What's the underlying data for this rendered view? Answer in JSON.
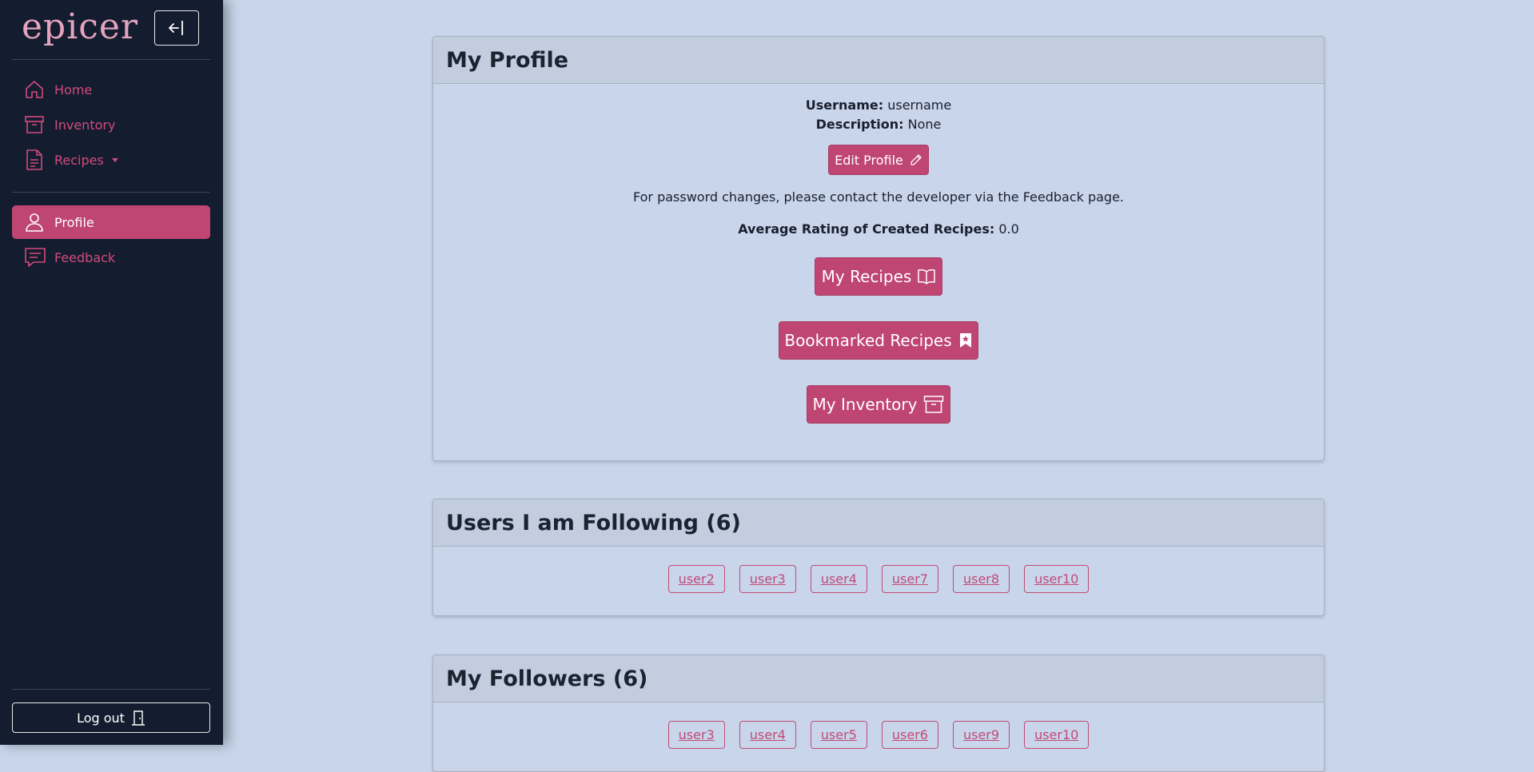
{
  "sidebar": {
    "logo": "epicer",
    "nav": [
      {
        "label": "Home",
        "icon": "home-icon"
      },
      {
        "label": "Inventory",
        "icon": "archive-icon"
      },
      {
        "label": "Recipes",
        "icon": "document-icon"
      }
    ],
    "nav2": [
      {
        "label": "Profile",
        "icon": "user-icon"
      },
      {
        "label": "Feedback",
        "icon": "chat-icon"
      }
    ],
    "logout_label": "Log out"
  },
  "profile": {
    "title": "My Profile",
    "username_label": "Username:",
    "username_value": "username",
    "description_label": "Description:",
    "description_value": "None",
    "edit_label": "Edit Profile",
    "password_note": "For password changes, please contact the developer via the Feedback page.",
    "rating_label": "Average Rating of Created Recipes:",
    "rating_value": "0.0",
    "my_recipes_label": "My Recipes",
    "bookmarked_label": "Bookmarked Recipes",
    "inventory_label": "My Inventory"
  },
  "following": {
    "title": "Users I am Following (6)",
    "users": [
      "user2",
      "user3",
      "user4",
      "user7",
      "user8",
      "user10"
    ]
  },
  "followers": {
    "title": "My Followers (6)",
    "users": [
      "user3",
      "user4",
      "user5",
      "user6",
      "user9",
      "user10"
    ]
  },
  "colors": {
    "accent": "#bf4573",
    "sidebar_bg": "#141d2f",
    "page_bg": "#c8d5eb"
  }
}
